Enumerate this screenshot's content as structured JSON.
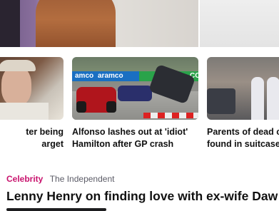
{
  "stories": [
    {
      "title_line1": "ter being",
      "title_line2": "arget"
    },
    {
      "title_line1": "Alfonso lashes out at 'idiot'",
      "title_line2": "Hamilton after GP crash"
    },
    {
      "title_line1": "Parents of dead c",
      "title_line2": "found in suitcase"
    }
  ],
  "ad_banners": [
    "amco",
    "aramco",
    "CO"
  ],
  "feature": {
    "category": "Celebrity",
    "source": "The Independent",
    "headline": "Lenny Henry on finding love with ex-wife Daw"
  },
  "colors": {
    "category": "#c8126d",
    "banner_blue": "#1a6fc2",
    "banner_green": "#2aa34a"
  }
}
